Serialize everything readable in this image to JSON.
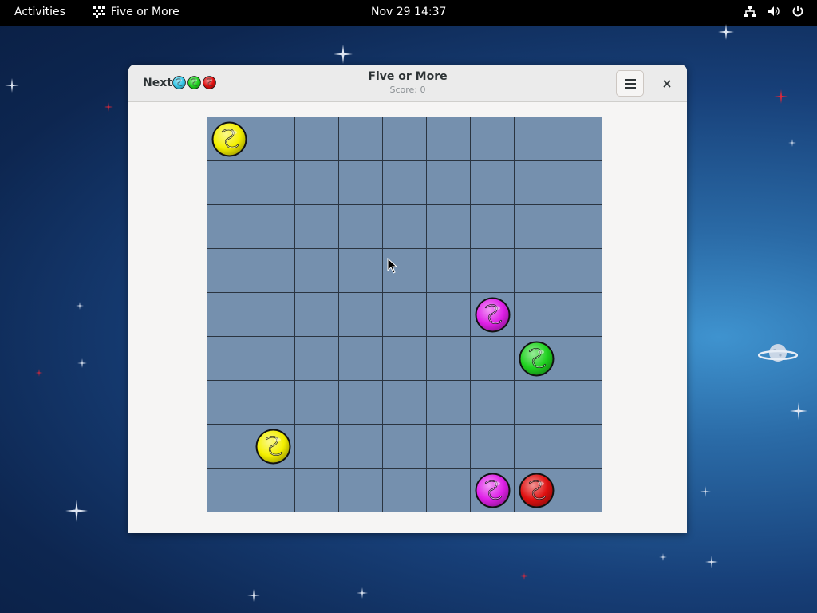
{
  "topbar": {
    "activities": "Activities",
    "app_name": "Five or More",
    "clock": "Nov 29  14:37",
    "tray_icons": [
      "network-icon",
      "volume-icon",
      "power-icon"
    ]
  },
  "window": {
    "title": "Five or More",
    "subtitle": "Score: 0",
    "next_label": "Next:",
    "next_balls": [
      "cyan",
      "green",
      "red"
    ],
    "menu_icon": "hamburger-menu-icon",
    "close_icon": "close-icon"
  },
  "board": {
    "rows": 9,
    "cols": 9,
    "balls": [
      {
        "row": 0,
        "col": 0,
        "color": "yellow"
      },
      {
        "row": 4,
        "col": 6,
        "color": "magenta"
      },
      {
        "row": 5,
        "col": 7,
        "color": "green"
      },
      {
        "row": 7,
        "col": 1,
        "color": "yellow"
      },
      {
        "row": 8,
        "col": 6,
        "color": "magenta"
      },
      {
        "row": 8,
        "col": 7,
        "color": "red"
      }
    ]
  },
  "colors": {
    "yellow": "#f4f000",
    "magenta": "#e020e8",
    "green": "#1fd21f",
    "red": "#e01010",
    "cyan": "#38c8e8",
    "board_bg": "#7590ae",
    "grid_line": "#2a3440"
  }
}
